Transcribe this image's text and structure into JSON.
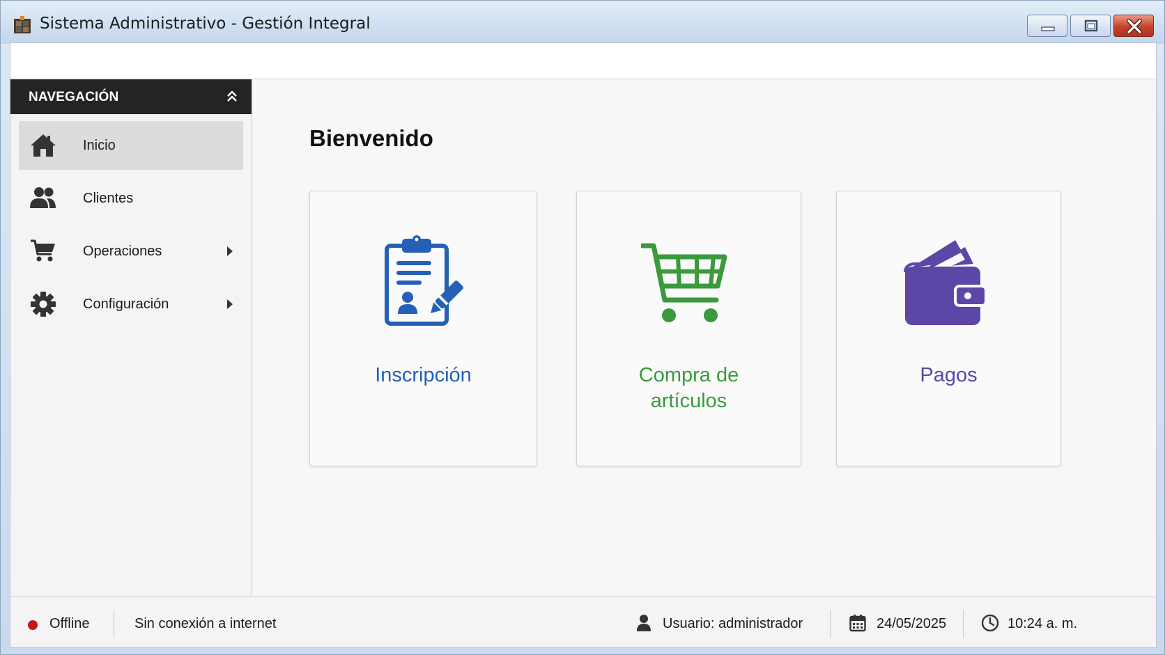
{
  "window": {
    "title": "Sistema Administrativo - Gestión Integral",
    "app_icon": "app-icon",
    "controls": [
      "minimize-icon",
      "maximize-icon",
      "close-icon"
    ]
  },
  "sidebar": {
    "header_label": "NAVEGACIÓN",
    "collapse_icon": "chevron-double-up-icon",
    "items": [
      {
        "label": "Inicio",
        "icon": "home-icon",
        "active": true,
        "submenu": false
      },
      {
        "label": "Clientes",
        "icon": "users-icon",
        "active": false,
        "submenu": false
      },
      {
        "label": "Operaciones",
        "icon": "cart-icon",
        "active": false,
        "submenu": true
      },
      {
        "label": "Configuración",
        "icon": "gear-icon",
        "active": false,
        "submenu": true
      }
    ]
  },
  "main": {
    "heading": "Bienvenido",
    "cards": [
      {
        "label": "Inscripción",
        "icon": "clipboard-edit-icon",
        "color": "#2460b5"
      },
      {
        "label_line1": "Compra de",
        "label_line2": "artículos",
        "icon": "shopping-cart-icon",
        "color": "#3a9a3c"
      },
      {
        "label": "Pagos",
        "icon": "wallet-icon",
        "color": "#5c47a6"
      }
    ]
  },
  "status": {
    "connection": "Offline",
    "connection_color": "#c8161e",
    "message": "Sin conexión a internet",
    "user": "Usuario: administrador",
    "date": "24/05/2025",
    "time": "10:24 a. m."
  }
}
